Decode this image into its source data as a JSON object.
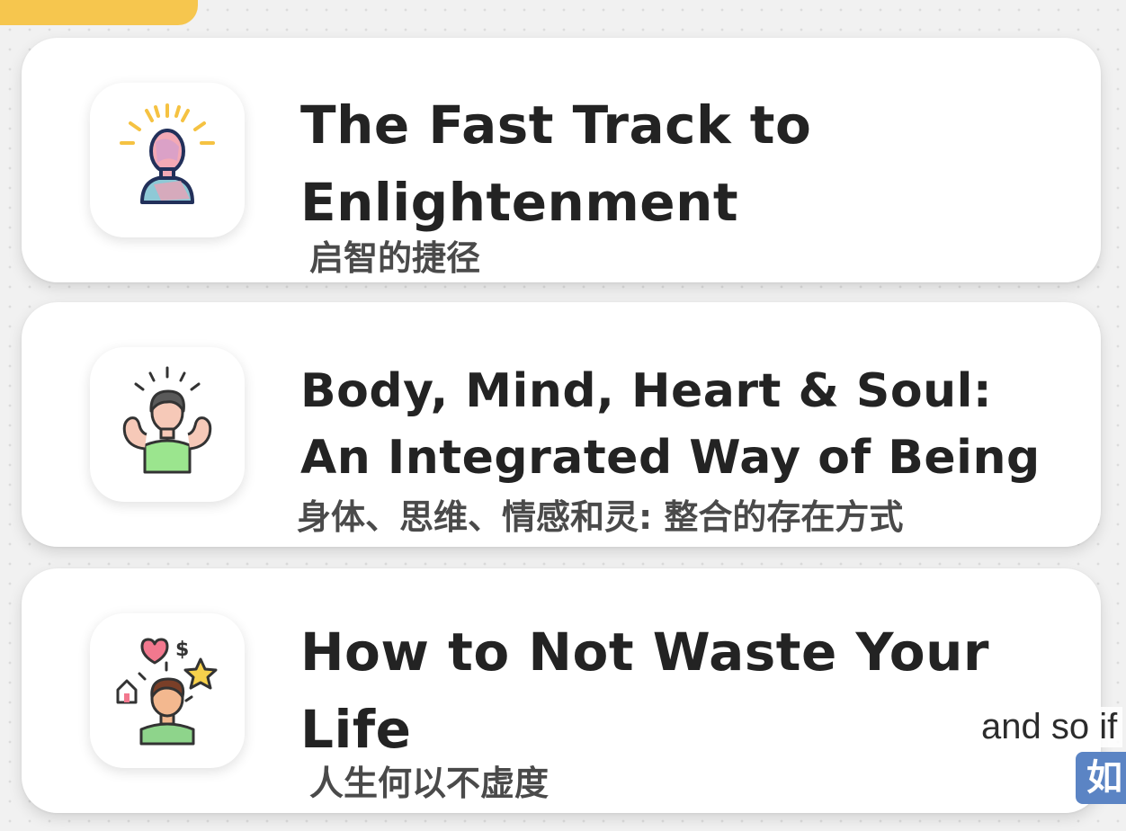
{
  "cards": [
    {
      "title": "The Fast Track to Enlightenment",
      "subtitle": "启智的捷径",
      "icon": "enlightened-person-icon"
    },
    {
      "title_line1": "Body, Mind, Heart & Soul:",
      "title_line2": "An Integrated Way of Being",
      "subtitle": "身体、思维、情感和灵: 整合的存在方式",
      "icon": "strong-person-icon"
    },
    {
      "title": "How to Not Waste Your Life",
      "subtitle": "人生何以不虚度",
      "icon": "life-goals-person-icon"
    }
  ],
  "captions": {
    "english": "and so if",
    "chinese": "如"
  },
  "colors": {
    "accent_tab": "#f6c64e",
    "caption_highlight": "#5b84c4",
    "title_text": "#232323"
  }
}
